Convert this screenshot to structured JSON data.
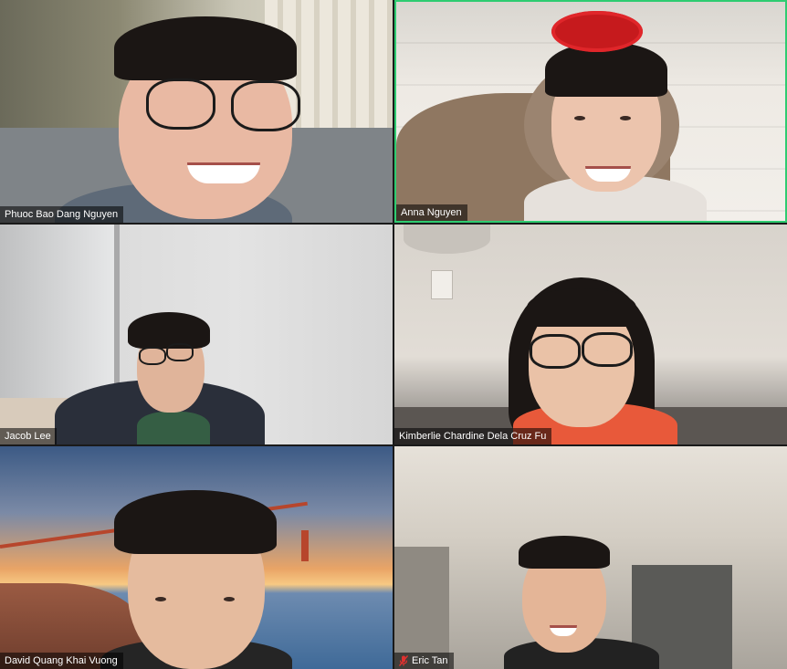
{
  "participants": [
    {
      "name": "Phuoc Bao Dang Nguyen",
      "muted": false,
      "active": false
    },
    {
      "name": "Anna Nguyen",
      "muted": false,
      "active": true
    },
    {
      "name": "Jacob Lee",
      "muted": false,
      "active": false
    },
    {
      "name": "Kimberlie Chardine Dela Cruz Fu",
      "muted": false,
      "active": false
    },
    {
      "name": "David Quang Khai Vuong",
      "muted": false,
      "active": false
    },
    {
      "name": "Eric Tan",
      "muted": true,
      "active": false
    }
  ],
  "colors": {
    "active_speaker_border": "#2ecc71",
    "mute_icon": "#e0312f"
  },
  "icons": {
    "muted": "microphone-muted-icon"
  }
}
